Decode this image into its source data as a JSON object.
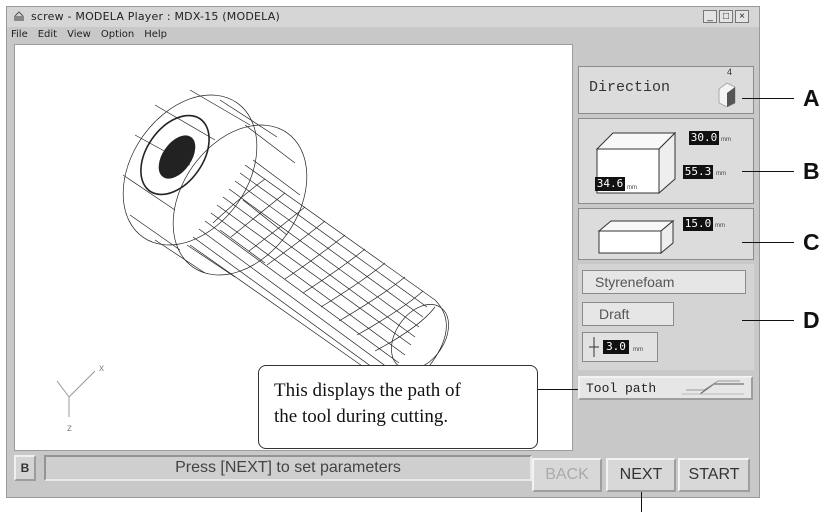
{
  "window": {
    "title": "screw - MODELA Player  : MDX-15 (MODELA)",
    "controls": [
      "_",
      "□",
      "×"
    ]
  },
  "menu": [
    "File",
    "Edit",
    "View",
    "Option",
    "Help"
  ],
  "direction": {
    "label": "Direction",
    "axis": "4"
  },
  "dimensions": {
    "height": "30.0",
    "width": "55.3",
    "depth": "34.6",
    "unit": "mm"
  },
  "thickness": {
    "value": "15.0",
    "unit": "mm"
  },
  "material": {
    "name": "Styrenefoam",
    "quality": "Draft",
    "tool_value": "3.0",
    "unit": "mm"
  },
  "toolpath": {
    "label": "Tool path"
  },
  "axes": {
    "x": "x",
    "z": "z"
  },
  "status": {
    "icon_label": "B",
    "message": "Press [NEXT] to set parameters"
  },
  "buttons": {
    "back": "BACK",
    "next": "NEXT",
    "start": "START"
  },
  "callout": {
    "line1": "This displays the path of",
    "line2": "the tool during cutting."
  },
  "labels": {
    "a": "A",
    "b": "B",
    "c": "C",
    "d": "D"
  }
}
